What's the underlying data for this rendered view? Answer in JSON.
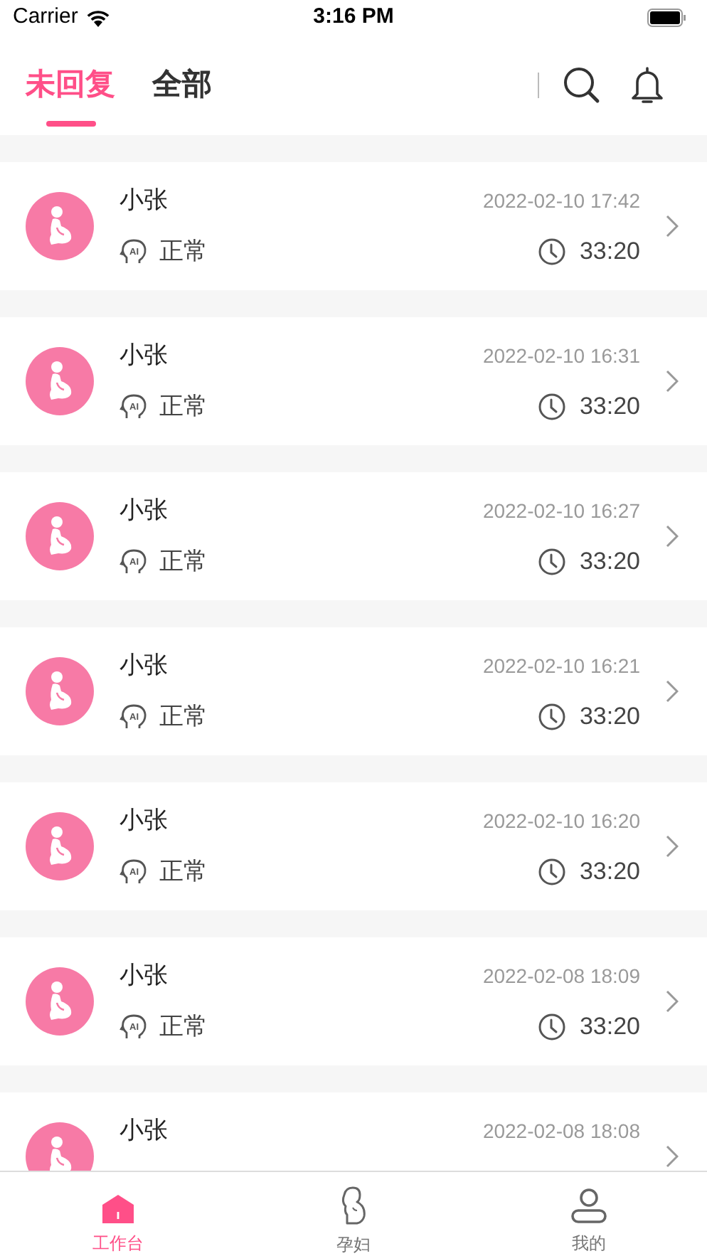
{
  "status_bar": {
    "carrier": "Carrier",
    "time": "3:16 PM"
  },
  "tabs": [
    {
      "label": "未回复",
      "selected": true
    },
    {
      "label": "全部",
      "selected": false
    }
  ],
  "records": [
    {
      "name": "小张",
      "datetime": "2022-02-10 17:42",
      "ai_mark": "AI",
      "status": "正常",
      "duration": "33:20"
    },
    {
      "name": "小张",
      "datetime": "2022-02-10 16:31",
      "ai_mark": "AI",
      "status": "正常",
      "duration": "33:20"
    },
    {
      "name": "小张",
      "datetime": "2022-02-10 16:27",
      "ai_mark": "AI",
      "status": "正常",
      "duration": "33:20"
    },
    {
      "name": "小张",
      "datetime": "2022-02-10 16:21",
      "ai_mark": "AI",
      "status": "正常",
      "duration": "33:20"
    },
    {
      "name": "小张",
      "datetime": "2022-02-10 16:20",
      "ai_mark": "AI",
      "status": "正常",
      "duration": "33:20"
    },
    {
      "name": "小张",
      "datetime": "2022-02-08 18:09",
      "ai_mark": "AI",
      "status": "正常",
      "duration": "33:20"
    },
    {
      "name": "小张",
      "datetime": "2022-02-08 18:08"
    }
  ],
  "tab_bar": [
    {
      "label": "工作台",
      "kind": "home",
      "selected": true
    },
    {
      "label": "孕妇",
      "kind": "pregnant",
      "selected": false
    },
    {
      "label": "我的",
      "kind": "profile",
      "selected": false
    }
  ]
}
